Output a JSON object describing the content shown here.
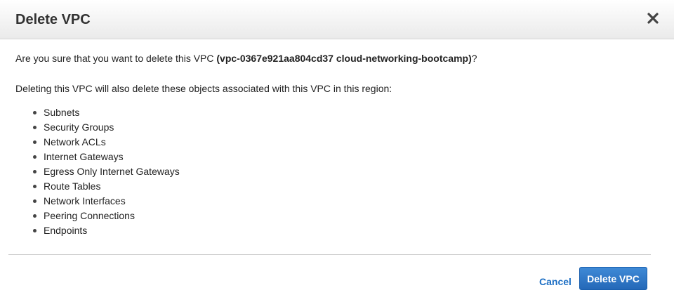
{
  "dialog": {
    "title": "Delete VPC",
    "close_icon": "close-icon",
    "confirm_prefix": "Are you sure that you want to delete this VPC ",
    "vpc_name": "(vpc-0367e921aa804cd37 cloud-networking-bootcamp)",
    "confirm_suffix": "?",
    "scope_text": "Deleting this VPC will also delete these objects associated with this VPC in this region:",
    "objects": [
      "Subnets",
      "Security Groups",
      "Network ACLs",
      "Internet Gateways",
      "Egress Only Internet Gateways",
      "Route Tables",
      "Network Interfaces",
      "Peering Connections",
      "Endpoints"
    ],
    "cancel_label": "Cancel",
    "delete_label": "Delete VPC"
  },
  "colors": {
    "primary_button": "#2468b8",
    "link": "#1d6fc4"
  }
}
